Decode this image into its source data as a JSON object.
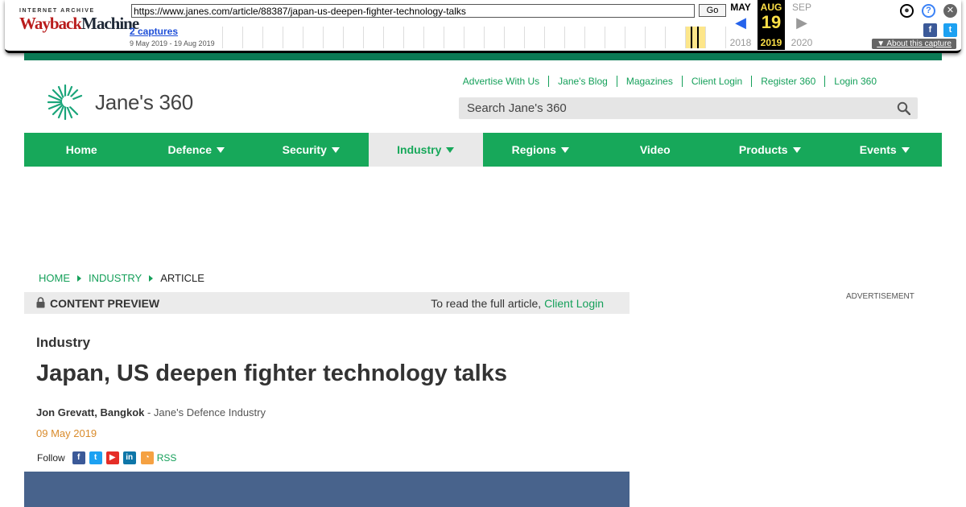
{
  "wayback": {
    "logo_top": "INTERNET ARCHIVE",
    "logo_main_a": "Wayback",
    "logo_main_b": "Machine",
    "url": "https://www.janes.com/article/88387/japan-us-deepen-fighter-technology-talks",
    "go_label": "Go",
    "captures_label": "2 captures",
    "date_range": "9 May 2019 - 19 Aug 2019",
    "prev_month": "MAY",
    "prev_year": "2018",
    "cur_month": "AUG",
    "cur_day": "19",
    "cur_year": "2019",
    "next_month": "SEP",
    "next_year": "2020",
    "about_label": "About this capture",
    "colors": {
      "highlight": "#fde68a",
      "selected_text": "#fde047"
    }
  },
  "site": {
    "logo_text": "Jane's 360",
    "utility_links": [
      "Advertise With Us",
      "Jane's Blog",
      "Magazines",
      "Client Login",
      "Register 360",
      "Login 360"
    ],
    "search_placeholder": "Search Jane's 360",
    "nav": [
      {
        "label": "Home",
        "caret": false,
        "active": false
      },
      {
        "label": "Defence",
        "caret": true,
        "active": false
      },
      {
        "label": "Security",
        "caret": true,
        "active": false
      },
      {
        "label": "Industry",
        "caret": true,
        "active": true
      },
      {
        "label": "Regions",
        "caret": true,
        "active": false
      },
      {
        "label": "Video",
        "caret": false,
        "active": false
      },
      {
        "label": "Products",
        "caret": true,
        "active": false
      },
      {
        "label": "Events",
        "caret": true,
        "active": false
      }
    ],
    "colors": {
      "brand_green": "#17a85a",
      "top_bar": "#0b7a55",
      "date": "#d98b2b"
    }
  },
  "breadcrumb": {
    "home": "HOME",
    "section": "INDUSTRY",
    "current": "ARTICLE"
  },
  "preview": {
    "label": "CONTENT PREVIEW",
    "read_text": "To read the full article,",
    "login_link": "Client Login"
  },
  "advertisement_label": "ADVERTISEMENT",
  "article": {
    "section": "Industry",
    "headline": "Japan, US deepen fighter technology talks",
    "author": "Jon Grevatt, Bangkok",
    "publication": " - Jane's Defence Industry",
    "date": "09 May 2019",
    "follow_label": "Follow",
    "rss_label": "RSS"
  }
}
